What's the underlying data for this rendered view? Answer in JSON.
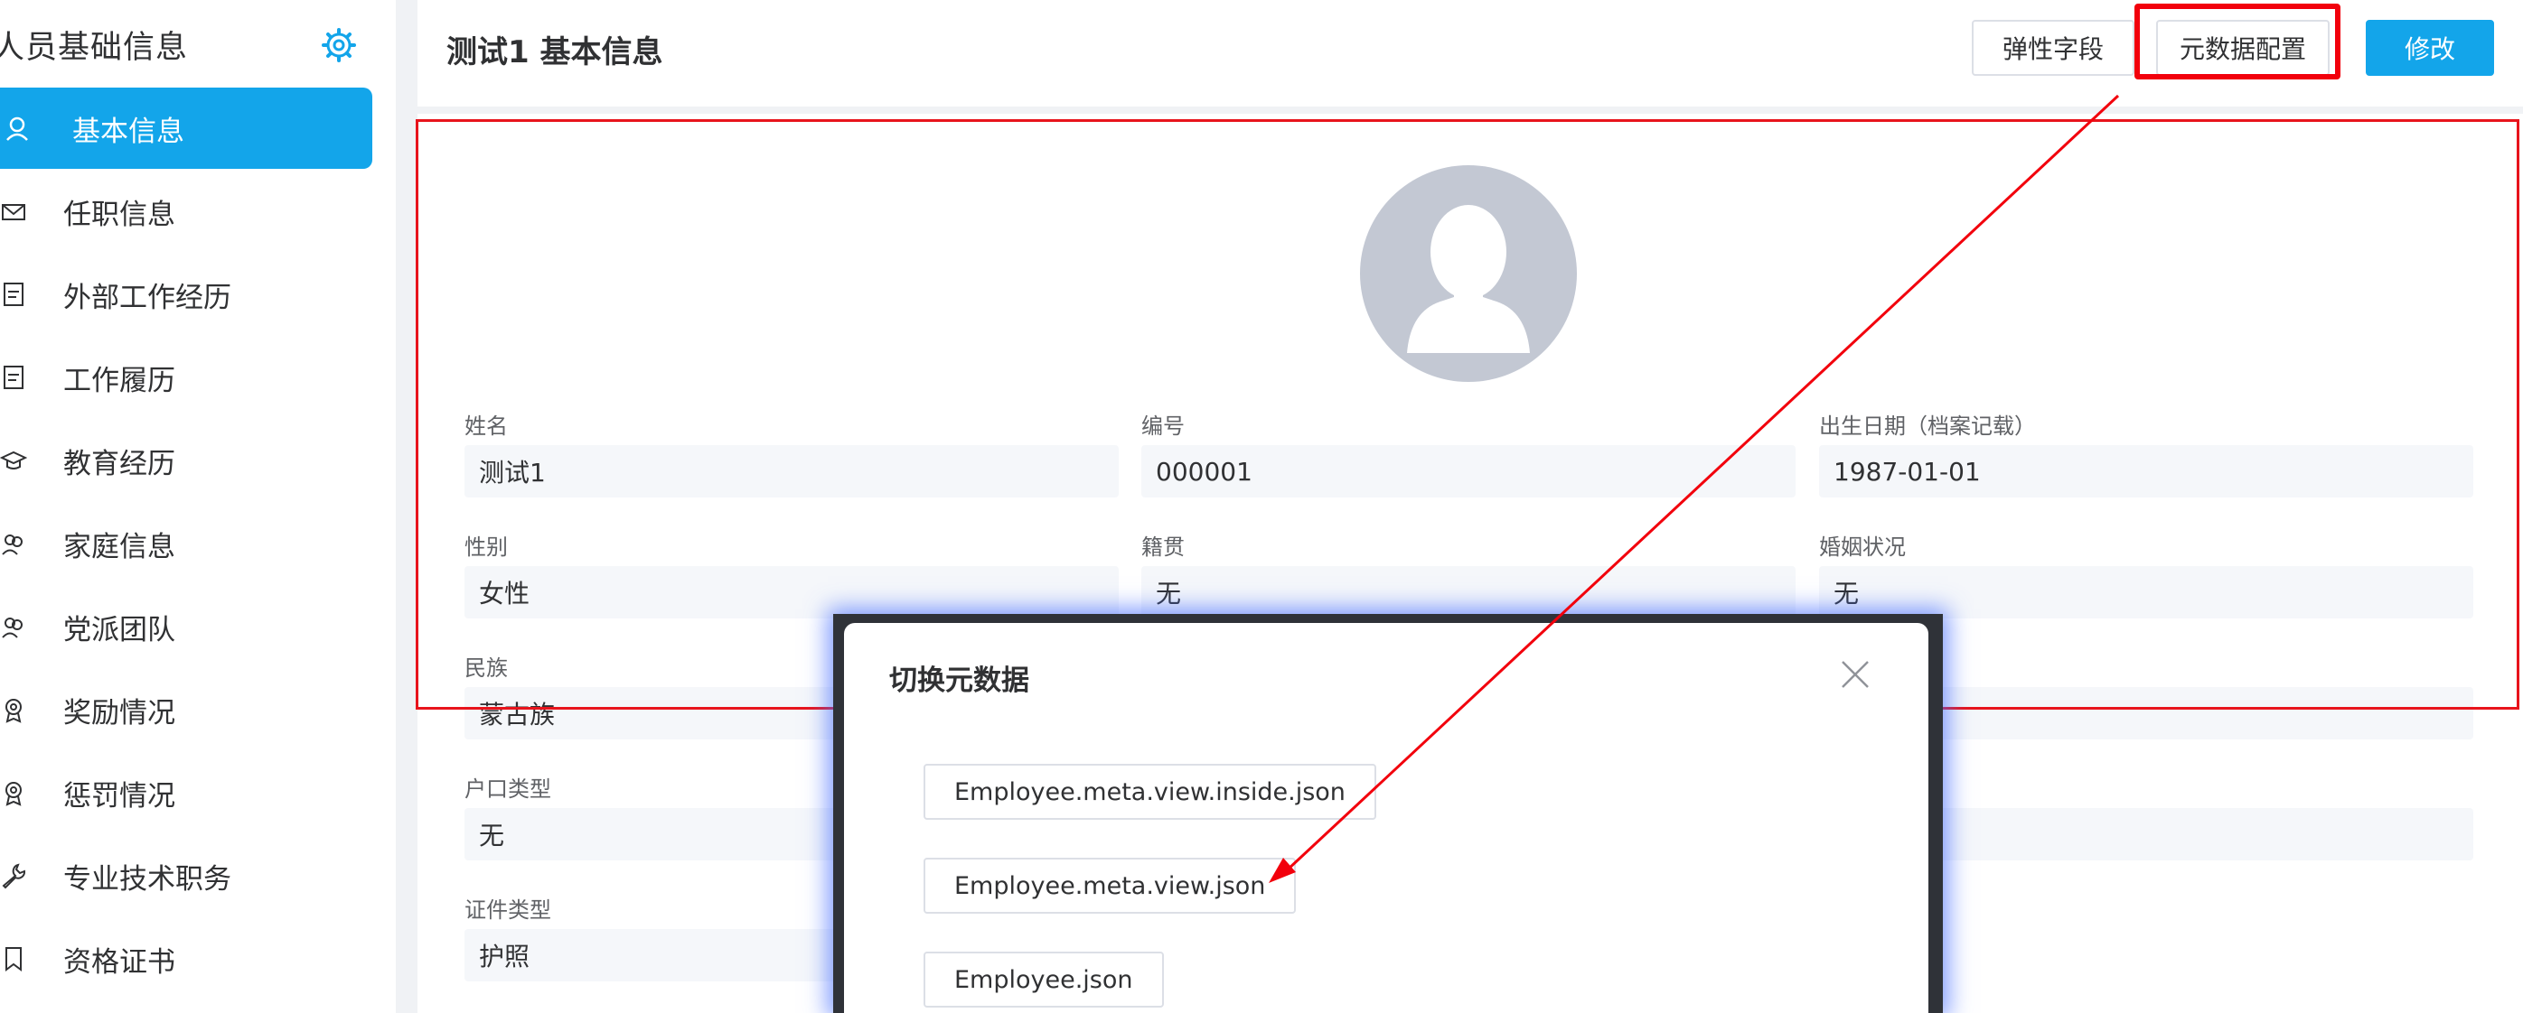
{
  "sidebar": {
    "title": "人员基础信息",
    "settings_icon": "gear-icon",
    "items": [
      {
        "label": "基本信息",
        "icon": "user-icon",
        "active": true
      },
      {
        "label": "任职信息",
        "icon": "envelope-icon"
      },
      {
        "label": "外部工作经历",
        "icon": "document-icon"
      },
      {
        "label": "工作履历",
        "icon": "document-icon"
      },
      {
        "label": "教育经历",
        "icon": "graduation-cap-icon"
      },
      {
        "label": "家庭信息",
        "icon": "people-icon"
      },
      {
        "label": "党派团队",
        "icon": "people-icon"
      },
      {
        "label": "奖励情况",
        "icon": "medal-icon"
      },
      {
        "label": "惩罚情况",
        "icon": "medal-icon"
      },
      {
        "label": "专业技术职务",
        "icon": "wrench-icon"
      },
      {
        "label": "资格证书",
        "icon": "bookmark-icon"
      }
    ]
  },
  "header": {
    "title": "测试1 基本信息",
    "buttons": {
      "flex_field": "弹性字段",
      "meta_config": "元数据配置",
      "edit": "修改"
    }
  },
  "form": {
    "fields": [
      {
        "label": "姓名",
        "value": "测试1"
      },
      {
        "label": "编号",
        "value": "000001"
      },
      {
        "label": "出生日期（档案记载）",
        "value": "1987-01-01"
      },
      {
        "label": "性别",
        "value": "女性"
      },
      {
        "label": "籍贯",
        "value": "无"
      },
      {
        "label": "婚姻状况",
        "value": "无"
      },
      {
        "label": "民族",
        "value": "蒙古族"
      },
      {
        "label": "户口类型",
        "value": "无"
      },
      {
        "label": "证件类型",
        "value": "护照"
      }
    ]
  },
  "modal": {
    "title": "切换元数据",
    "options": [
      "Employee.meta.view.inside.json",
      "Employee.meta.view.json",
      "Employee.json"
    ]
  },
  "colors": {
    "accent": "#13a5ea",
    "annotation": "#f2000c",
    "avatar": "#c3c8d3"
  }
}
